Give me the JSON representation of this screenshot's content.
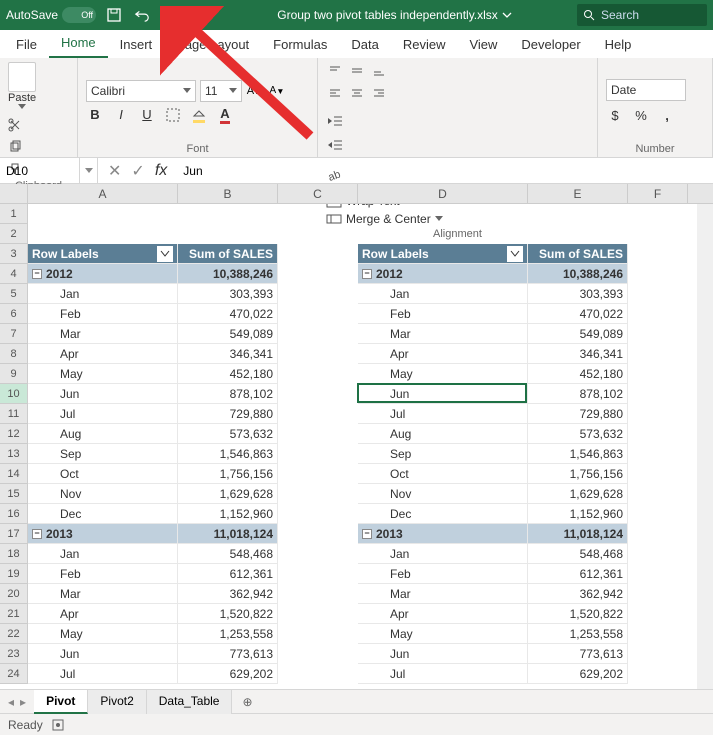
{
  "titlebar": {
    "autosave_label": "AutoSave",
    "autosave_state": "Off",
    "filename": "Group two pivot tables independently.xlsx",
    "search_placeholder": "Search"
  },
  "menu": {
    "tabs": [
      "File",
      "Home",
      "Insert",
      "Page Layout",
      "Formulas",
      "Data",
      "Review",
      "View",
      "Developer",
      "Help"
    ],
    "active": "Home"
  },
  "ribbon": {
    "clipboard": {
      "paste": "Paste",
      "label": "Clipboard"
    },
    "font": {
      "name": "Calibri",
      "size": "11",
      "label": "Font",
      "bold": "B",
      "italic": "I",
      "underline": "U"
    },
    "alignment": {
      "wrap": "Wrap Text",
      "merge": "Merge & Center",
      "label": "Alignment"
    },
    "number": {
      "format": "Date",
      "label": "Number"
    }
  },
  "formula_bar": {
    "namebox": "D10",
    "formula": "Jun"
  },
  "columns": [
    {
      "letter": "A",
      "width": 150
    },
    {
      "letter": "B",
      "width": 100
    },
    {
      "letter": "C",
      "width": 80
    },
    {
      "letter": "D",
      "width": 170
    },
    {
      "letter": "E",
      "width": 100
    },
    {
      "letter": "F",
      "width": 60
    }
  ],
  "row_start": 1,
  "row_end": 24,
  "pivot_headers": {
    "left": "Row Labels",
    "right": "Sum of SALES"
  },
  "pivot_data": [
    {
      "type": "year",
      "label": "2012",
      "value": "10,388,246"
    },
    {
      "type": "month",
      "label": "Jan",
      "value": "303,393"
    },
    {
      "type": "month",
      "label": "Feb",
      "value": "470,022"
    },
    {
      "type": "month",
      "label": "Mar",
      "value": "549,089"
    },
    {
      "type": "month",
      "label": "Apr",
      "value": "346,341"
    },
    {
      "type": "month",
      "label": "May",
      "value": "452,180"
    },
    {
      "type": "month",
      "label": "Jun",
      "value": "878,102"
    },
    {
      "type": "month",
      "label": "Jul",
      "value": "729,880"
    },
    {
      "type": "month",
      "label": "Aug",
      "value": "573,632"
    },
    {
      "type": "month",
      "label": "Sep",
      "value": "1,546,863"
    },
    {
      "type": "month",
      "label": "Oct",
      "value": "1,756,156"
    },
    {
      "type": "month",
      "label": "Nov",
      "value": "1,629,628"
    },
    {
      "type": "month",
      "label": "Dec",
      "value": "1,152,960"
    },
    {
      "type": "year",
      "label": "2013",
      "value": "11,018,124"
    },
    {
      "type": "month",
      "label": "Jan",
      "value": "548,468"
    },
    {
      "type": "month",
      "label": "Feb",
      "value": "612,361"
    },
    {
      "type": "month",
      "label": "Mar",
      "value": "362,942"
    },
    {
      "type": "month",
      "label": "Apr",
      "value": "1,520,822"
    },
    {
      "type": "month",
      "label": "May",
      "value": "1,253,558"
    },
    {
      "type": "month",
      "label": "Jun",
      "value": "773,613"
    },
    {
      "type": "month",
      "label": "Jul",
      "value": "629,202"
    }
  ],
  "active_cell": {
    "col": "D",
    "row": 10
  },
  "sheets": {
    "tabs": [
      "Pivot",
      "Pivot2",
      "Data_Table"
    ],
    "active": "Pivot"
  },
  "status": {
    "text": "Ready"
  },
  "colors": {
    "excel_green": "#217346",
    "pivot_header_bg": "#5b7e95",
    "pivot_year_bg": "#c0d0dd",
    "arrow": "#e62e2e"
  }
}
